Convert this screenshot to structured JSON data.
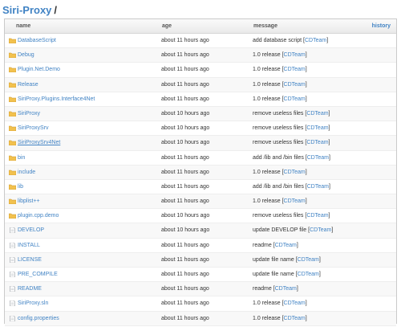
{
  "breadcrumb": {
    "repo": "Siri-Proxy",
    "separator": "/"
  },
  "columns": {
    "name": "name",
    "age": "age",
    "message": "message",
    "history": "history"
  },
  "colors": {
    "link": "#4183c4",
    "folder": "#f2c14e",
    "file": "#9aa0a6"
  },
  "rows": [
    {
      "type": "folder",
      "name": "DatabaseScript",
      "age": "about 11 hours ago",
      "message": "add database script",
      "author": "CDTeam"
    },
    {
      "type": "folder",
      "name": "Debug",
      "age": "about 11 hours ago",
      "message": "1.0 release",
      "author": "CDTeam"
    },
    {
      "type": "folder",
      "name": "Plugin.Net.Demo",
      "age": "about 11 hours ago",
      "message": "1.0 release",
      "author": "CDTeam"
    },
    {
      "type": "folder",
      "name": "Release",
      "age": "about 11 hours ago",
      "message": "1.0 release",
      "author": "CDTeam"
    },
    {
      "type": "folder",
      "name": "SiriProxy.Plugins.Interface4Net",
      "age": "about 11 hours ago",
      "message": "1.0 release",
      "author": "CDTeam"
    },
    {
      "type": "folder",
      "name": "SiriProxy",
      "age": "about 10 hours ago",
      "message": "remove useless files",
      "author": "CDTeam"
    },
    {
      "type": "folder",
      "name": "SiriProxySrv",
      "age": "about 10 hours ago",
      "message": "remove useless files",
      "author": "CDTeam"
    },
    {
      "type": "folder",
      "name": "SiriProxySrv4Net",
      "age": "about 10 hours ago",
      "message": "remove useless files",
      "author": "CDTeam",
      "underline": true
    },
    {
      "type": "folder",
      "name": "bin",
      "age": "about 11 hours ago",
      "message": "add /lib and /bin files",
      "author": "CDTeam"
    },
    {
      "type": "folder",
      "name": "include",
      "age": "about 11 hours ago",
      "message": "1.0 release",
      "author": "CDTeam"
    },
    {
      "type": "folder",
      "name": "lib",
      "age": "about 11 hours ago",
      "message": "add /lib and /bin files",
      "author": "CDTeam"
    },
    {
      "type": "folder",
      "name": "libplist++",
      "age": "about 11 hours ago",
      "message": "1.0 release",
      "author": "CDTeam"
    },
    {
      "type": "folder",
      "name": "plugin.cpp.demo",
      "age": "about 10 hours ago",
      "message": "remove useless files",
      "author": "CDTeam"
    },
    {
      "type": "file",
      "name": "DEVELOP",
      "age": "about 10 hours ago",
      "message": "update DEVELOP file",
      "author": "CDTeam"
    },
    {
      "type": "file",
      "name": "INSTALL",
      "age": "about 11 hours ago",
      "message": "readme",
      "author": "CDTeam"
    },
    {
      "type": "file",
      "name": "LICENSE",
      "age": "about 11 hours ago",
      "message": "update file name",
      "author": "CDTeam"
    },
    {
      "type": "file",
      "name": "PRE_COMPILE",
      "age": "about 11 hours ago",
      "message": "update file name",
      "author": "CDTeam"
    },
    {
      "type": "file",
      "name": "README",
      "age": "about 11 hours ago",
      "message": "readme",
      "author": "CDTeam"
    },
    {
      "type": "file",
      "name": "SiriProxy.sln",
      "age": "about 11 hours ago",
      "message": "1.0 release",
      "author": "CDTeam"
    },
    {
      "type": "file",
      "name": "config.properties",
      "age": "about 11 hours ago",
      "message": "1.0 release",
      "author": "CDTeam"
    }
  ]
}
